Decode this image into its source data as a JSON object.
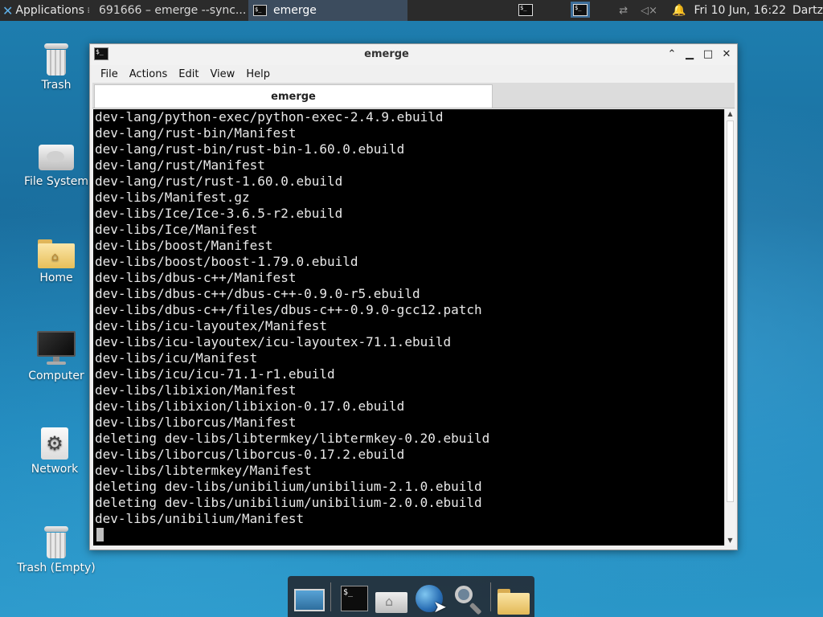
{
  "top_panel": {
    "applications_label": "Applications",
    "tasks": [
      {
        "label": "691666 – emerge --sync..."
      },
      {
        "label": "emerge"
      }
    ],
    "clock": "Fri 10 Jun, 16:22",
    "user": "Dartz"
  },
  "desktop_icons": [
    {
      "label": "Trash"
    },
    {
      "label": "File System"
    },
    {
      "label": "Home"
    },
    {
      "label": "Computer"
    },
    {
      "label": "Network"
    },
    {
      "label": "Trash (Empty)"
    }
  ],
  "window": {
    "title": "emerge",
    "menu": [
      "File",
      "Actions",
      "Edit",
      "View",
      "Help"
    ],
    "tab_label": "emerge",
    "terminal_lines": [
      "dev-lang/python-exec/python-exec-2.4.9.ebuild",
      "dev-lang/rust-bin/Manifest",
      "dev-lang/rust-bin/rust-bin-1.60.0.ebuild",
      "dev-lang/rust/Manifest",
      "dev-lang/rust/rust-1.60.0.ebuild",
      "dev-libs/Manifest.gz",
      "dev-libs/Ice/Ice-3.6.5-r2.ebuild",
      "dev-libs/Ice/Manifest",
      "dev-libs/boost/Manifest",
      "dev-libs/boost/boost-1.79.0.ebuild",
      "dev-libs/dbus-c++/Manifest",
      "dev-libs/dbus-c++/dbus-c++-0.9.0-r5.ebuild",
      "dev-libs/dbus-c++/files/dbus-c++-0.9.0-gcc12.patch",
      "dev-libs/icu-layoutex/Manifest",
      "dev-libs/icu-layoutex/icu-layoutex-71.1.ebuild",
      "dev-libs/icu/Manifest",
      "dev-libs/icu/icu-71.1-r1.ebuild",
      "dev-libs/libixion/Manifest",
      "dev-libs/libixion/libixion-0.17.0.ebuild",
      "dev-libs/liborcus/Manifest",
      "deleting dev-libs/libtermkey/libtermkey-0.20.ebuild",
      "dev-libs/liborcus/liborcus-0.17.2.ebuild",
      "dev-libs/libtermkey/Manifest",
      "deleting dev-libs/unibilium/unibilium-2.1.0.ebuild",
      "deleting dev-libs/unibilium/unibilium-2.0.0.ebuild",
      "dev-libs/unibilium/Manifest"
    ]
  },
  "icons": {
    "apps": "xfce-logo-icon",
    "firefox": "firefox-icon",
    "terminal": "terminal-icon",
    "network": "network-disconnected-icon",
    "volume": "volume-muted-icon",
    "notifications": "bell-icon"
  },
  "colors": {
    "panel_bg": "#2b2b2b",
    "desktop_bg": "#1e7fb0",
    "terminal_bg": "#000000",
    "terminal_fg": "#e8e8e8"
  }
}
